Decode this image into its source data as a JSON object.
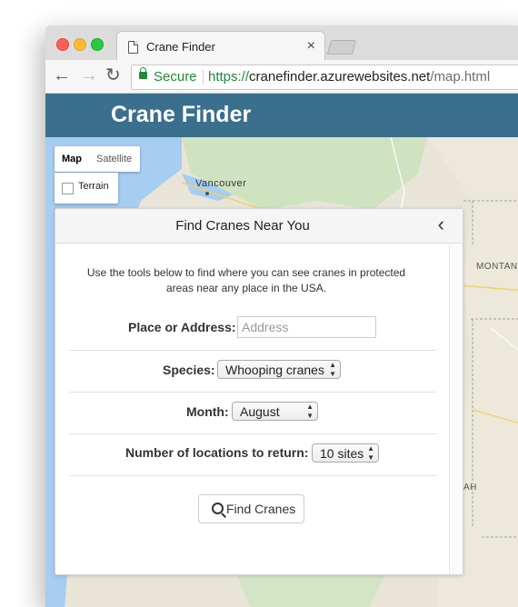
{
  "browser": {
    "tab_title": "Crane Finder",
    "tab_close": "×",
    "security_label": "Secure",
    "url_scheme": "https://",
    "url_host": "cranefinder.azurewebsites.net",
    "url_path": "/map.html",
    "back_icon": "back-arrow-icon",
    "forward_icon": "forward-arrow-icon",
    "reload_icon": "reload-icon"
  },
  "header": {
    "title": "Crane Finder"
  },
  "map": {
    "type_map_label": "Map",
    "type_satellite_label": "Satellite",
    "terrain_label": "Terrain",
    "terrain_checked": false,
    "labels": {
      "vancouver": "Vancouver",
      "montana": "MONTAN",
      "utah": "AH"
    }
  },
  "panel": {
    "title": "Find Cranes Near You",
    "collapse_icon": "chevron-left-icon",
    "intro": "Use the tools below to find where you can see cranes in protected areas near any place in the USA.",
    "place_label": "Place or Address:",
    "place_placeholder": "Address",
    "species_label": "Species:",
    "species_value": "Whooping cranes",
    "month_label": "Month:",
    "month_value": "August",
    "count_label": "Number of locations to return:",
    "count_value": "10 sites",
    "button_label": "Find Cranes",
    "button_icon": "search-icon"
  }
}
